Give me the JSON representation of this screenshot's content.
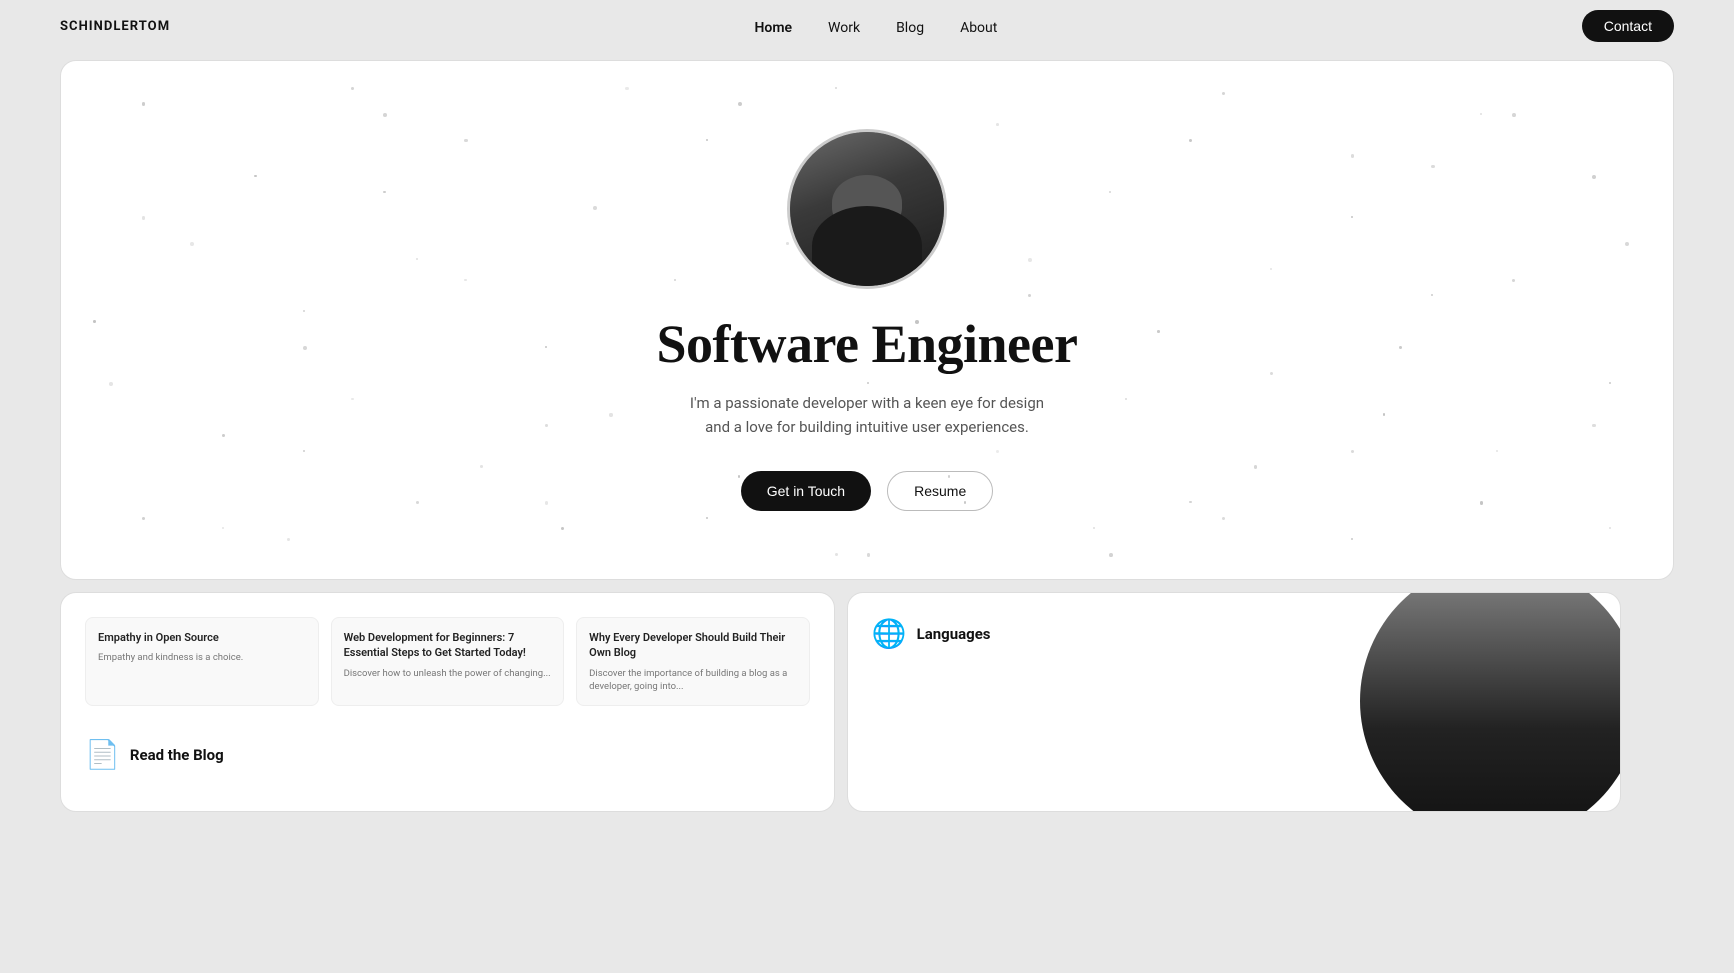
{
  "nav": {
    "logo": "SCHINDLERTOM",
    "links": [
      {
        "label": "Home",
        "active": true
      },
      {
        "label": "Work",
        "active": false
      },
      {
        "label": "Blog",
        "active": false
      },
      {
        "label": "About",
        "active": false
      }
    ],
    "contact_label": "Contact"
  },
  "hero": {
    "title": "Software Engineer",
    "subtitle": "I'm a passionate developer with a keen eye for design and a love for building intuitive user experiences.",
    "cta_primary": "Get in Touch",
    "cta_secondary": "Resume"
  },
  "blog": {
    "label": "Read the Blog",
    "posts": [
      {
        "title": "Empathy in Open Source",
        "description": "Empathy and kindness is a choice."
      },
      {
        "title": "Web Development for Beginners: 7 Essential Steps to Get Started Today!",
        "description": "Discover how to unleash the power of changing..."
      },
      {
        "title": "Why Every Developer Should Build Their Own Blog",
        "description": "Discover the importance of building a blog as a developer, going into..."
      }
    ]
  },
  "languages": {
    "label": "Languages"
  }
}
